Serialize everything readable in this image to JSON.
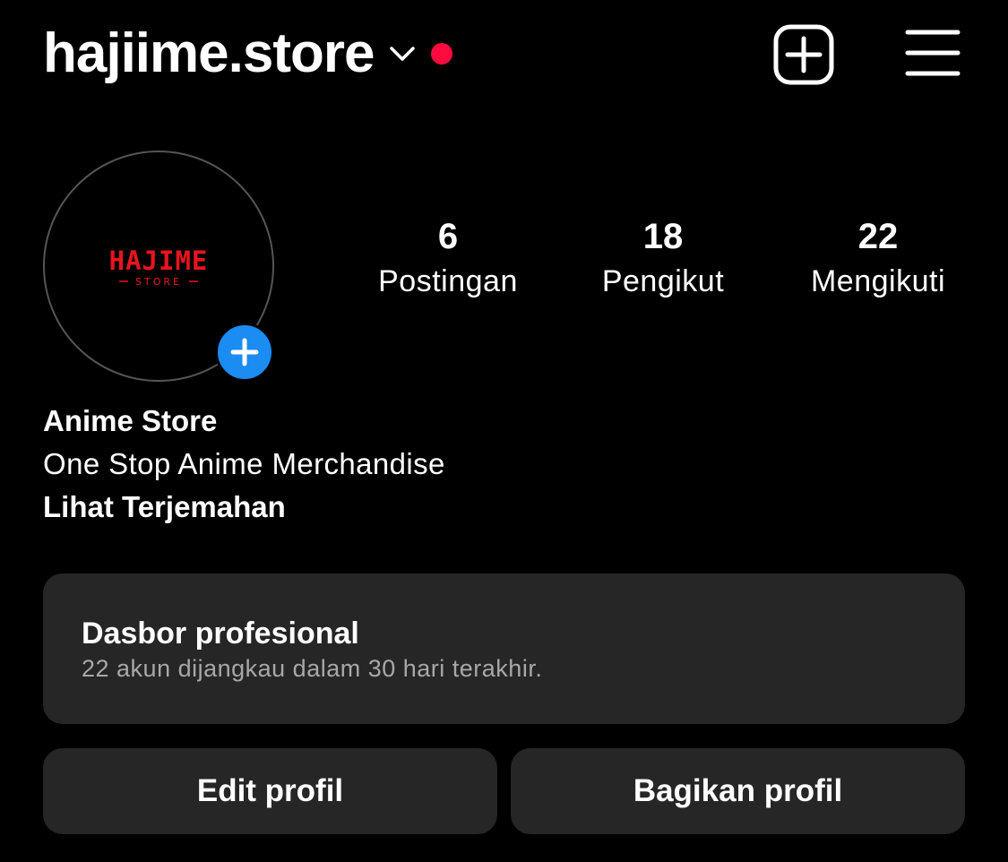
{
  "header": {
    "username": "hajiime.store",
    "accent_dot_color": "#ff0b3f"
  },
  "avatar": {
    "logo_text": "HAJIME",
    "logo_subtext": "STORE",
    "logo_color": "#e8141e",
    "add_story_color": "#1a8cf2"
  },
  "stats": {
    "posts": {
      "value": "6",
      "label": "Postingan"
    },
    "followers": {
      "value": "18",
      "label": "Pengikut"
    },
    "following": {
      "value": "22",
      "label": "Mengikuti"
    }
  },
  "bio": {
    "name": "Anime Store",
    "text": "One Stop Anime Merchandise",
    "translate_link": "Lihat Terjemahan"
  },
  "dashboard": {
    "title": "Dasbor profesional",
    "subtitle": "22 akun dijangkau dalam 30 hari terakhir."
  },
  "buttons": {
    "edit_profile": "Edit profil",
    "share_profile": "Bagikan profil"
  },
  "icons": {
    "chevron": "chevron-down-icon",
    "add": "plus-square-icon",
    "menu": "hamburger-menu-icon",
    "add_story": "plus-icon"
  }
}
